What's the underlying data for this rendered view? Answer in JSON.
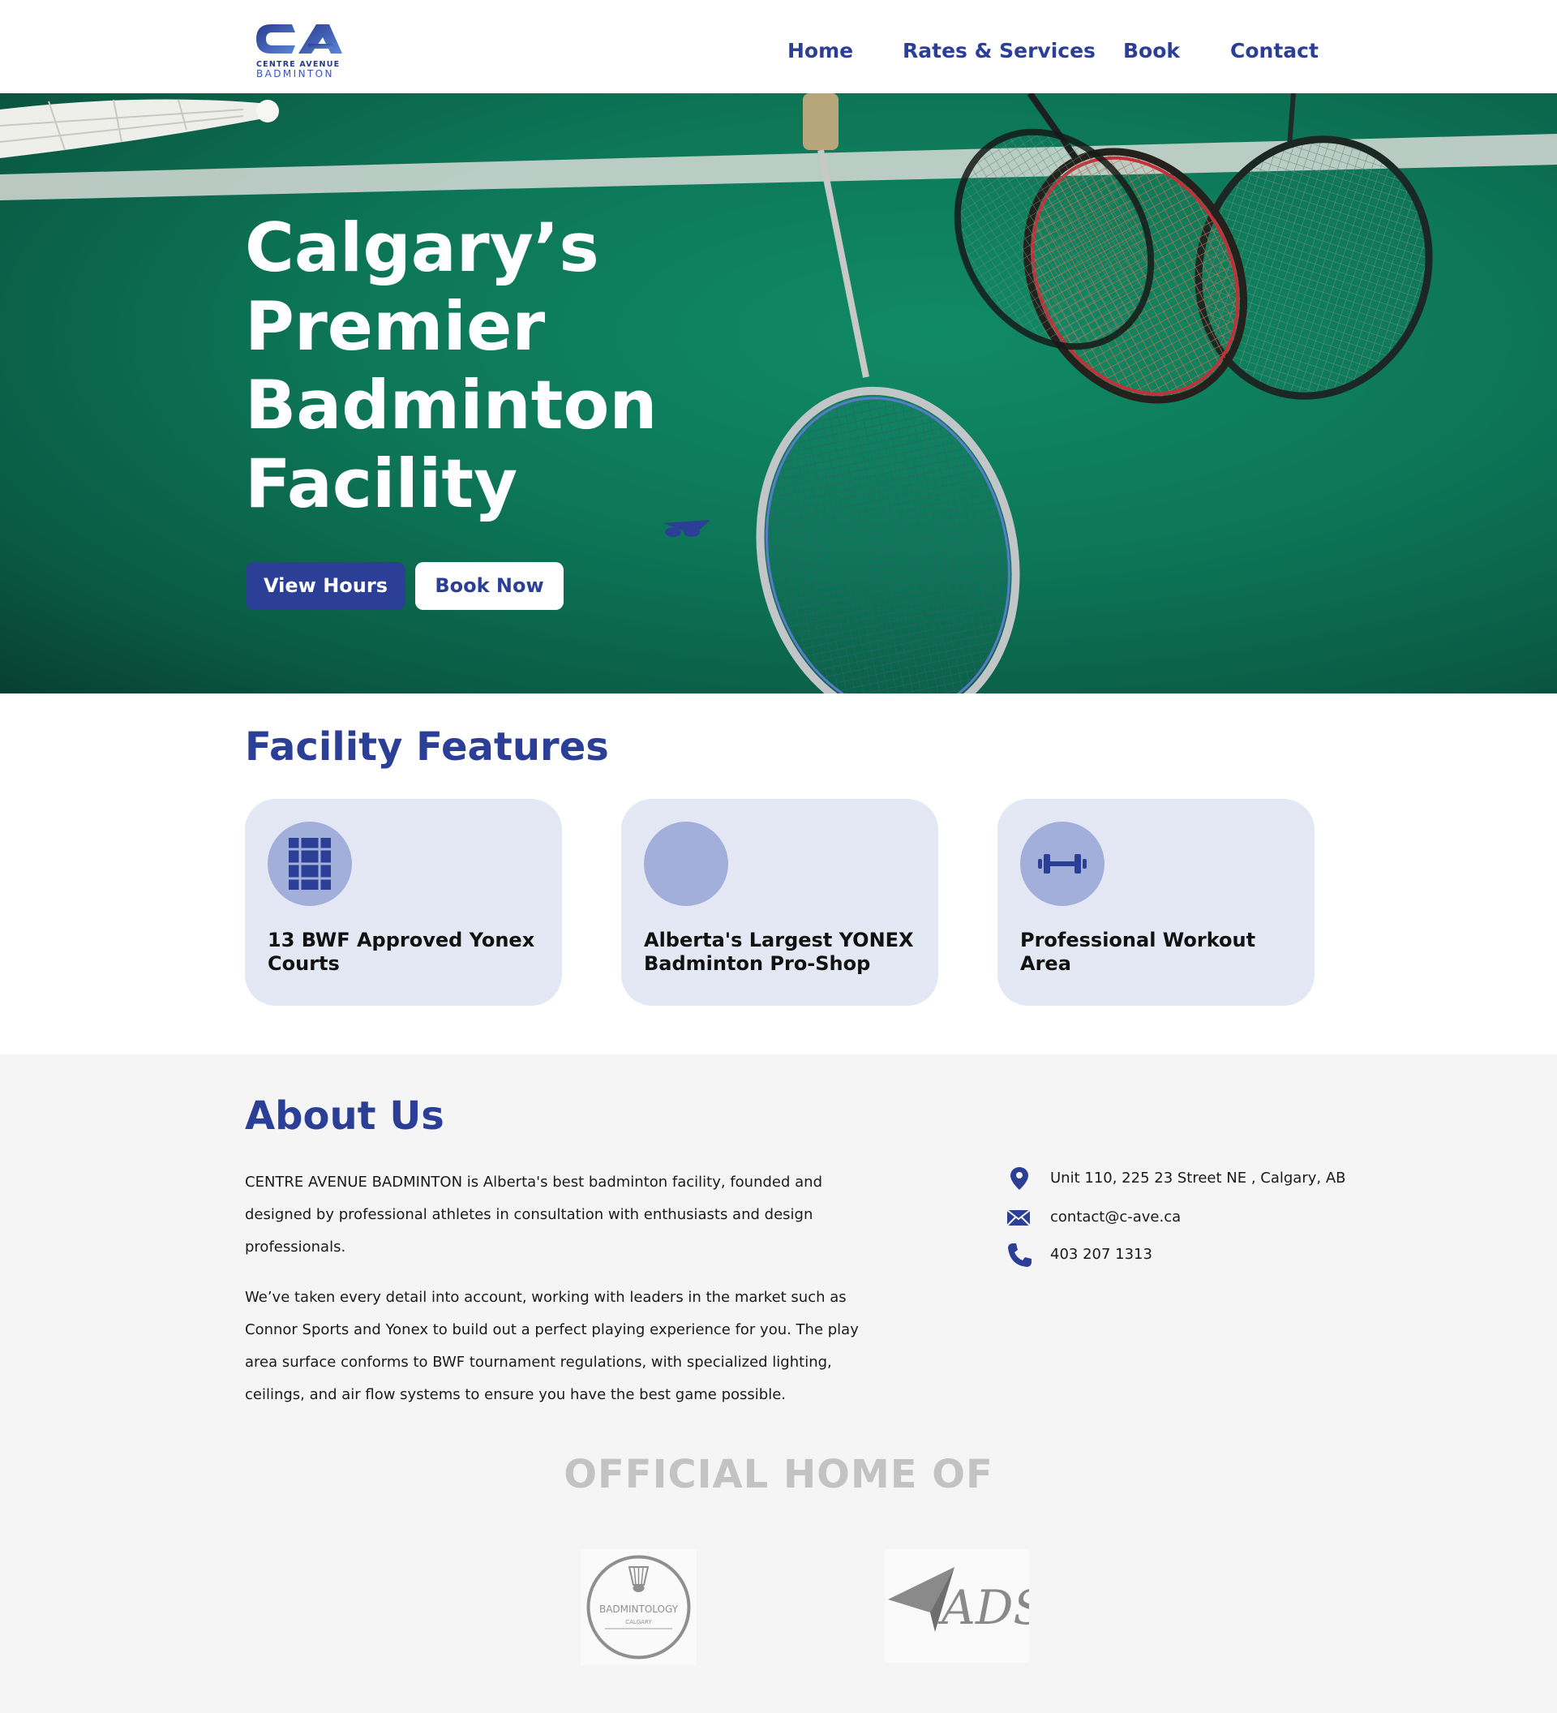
{
  "brand": {
    "logo_mark": "CA",
    "logo_line1": "CENTRE AVENUE",
    "logo_line2": "BADMINTON",
    "primary_color": "#2c3f96",
    "accent_color": "#a3afdb"
  },
  "nav": {
    "items": [
      {
        "label": "Home"
      },
      {
        "label": "Rates & Services"
      },
      {
        "label": "Book"
      },
      {
        "label": "Contact"
      }
    ]
  },
  "hero": {
    "title": "Calgary’s Premier Badminton Facility",
    "primary_button": "View Hours",
    "secondary_button": "Book Now"
  },
  "features": {
    "title": "Facility Features",
    "cards": [
      {
        "text": "13 BWF Approved Yonex Courts",
        "icon": "court-icon"
      },
      {
        "text": "Alberta's Largest YONEX Badminton Pro-Shop",
        "icon": "blank-icon"
      },
      {
        "text": "Professional Workout Area",
        "icon": "dumbbell-icon"
      }
    ]
  },
  "about": {
    "title": "About Us",
    "paragraphs": [
      "CENTRE AVENUE BADMINTON is Alberta's best badminton facility, founded and designed by professional athletes in consultation with enthusiasts and design professionals.",
      "We’ve taken every detail into account, working with leaders in the market such as Connor Sports and Yonex to build out a perfect playing experience for you. The play area surface conforms to BWF tournament regulations, with specialized lighting, ceilings, and air flow systems to ensure you have the best game possible."
    ],
    "contact": {
      "address": "Unit 110, 225 23 Street NE , Calgary, AB",
      "email": "contact@c-ave.ca",
      "phone": "403 207 1313"
    }
  },
  "official": {
    "title": "OFFICIAL HOME OF",
    "partners": [
      {
        "name": "BADMINTOLOGY",
        "subtitle": "CALGARY",
        "icon": "shuttlecock-icon"
      },
      {
        "name": "ADS",
        "icon": "paper-plane-icon"
      }
    ]
  }
}
